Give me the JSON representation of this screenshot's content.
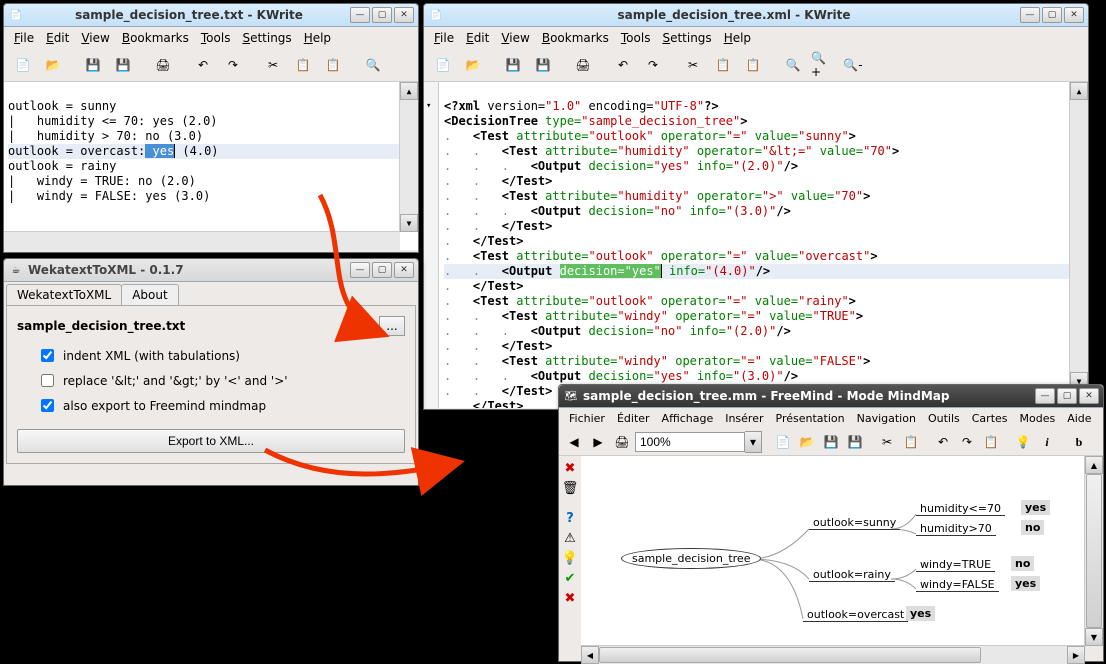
{
  "kwrite1": {
    "title": "sample_decision_tree.txt - KWrite",
    "menus": [
      "File",
      "Edit",
      "View",
      "Bookmarks",
      "Tools",
      "Settings",
      "Help"
    ],
    "lines": [
      {
        "text": "outlook = sunny"
      },
      {
        "text": "|   humidity <= 70: yes (2.0)"
      },
      {
        "text": "|   humidity > 70: no (3.0)"
      },
      {
        "hl": true,
        "prefix": "outlook = overcast:",
        "sel": " yes",
        "cursor": true,
        "suffix": " (4.0)"
      },
      {
        "text": "outlook = rainy"
      },
      {
        "text": "|   windy = TRUE: no (2.0)"
      },
      {
        "text": "|   windy = FALSE: yes (3.0)"
      }
    ]
  },
  "kwrite2": {
    "title": "sample_decision_tree.xml - KWrite",
    "menus": [
      "File",
      "Edit",
      "View",
      "Bookmarks",
      "Tools",
      "Settings",
      "Help"
    ]
  },
  "converter": {
    "title": "WekatextToXML - 0.1.7",
    "tab1": "WekatextToXML",
    "tab2": "About",
    "filename": "sample_decision_tree.txt",
    "opt_indent": "indent XML (with tabulations)",
    "opt_replace": "replace '&lt;' and '&gt;' by '<' and '>'",
    "opt_freemind": "also export to Freemind mindmap",
    "export_btn": "Export to XML..."
  },
  "freemind": {
    "title": "sample_decision_tree.mm - FreeMind - Mode MindMap",
    "menus": [
      "Fichier",
      "Éditer",
      "Affichage",
      "Insérer",
      "Présentation",
      "Navigation",
      "Outils",
      "Cartes",
      "Modes",
      "Aide"
    ],
    "zoom": "100%",
    "root": "sample_decision_tree",
    "b1": "outlook=sunny",
    "b2": "outlook=rainy",
    "b3": "outlook=overcast",
    "l1a": "humidity<=70",
    "l1a_val": "yes",
    "l1b": "humidity>70",
    "l1b_val": "no",
    "l2a": "windy=TRUE",
    "l2a_val": "no",
    "l2b": "windy=FALSE",
    "l2b_val": "yes",
    "l3_val": "yes"
  },
  "xml": {
    "l1": "<?xml version=\"1.0\" encoding=\"UTF-8\"?>",
    "tree_type": "sample_decision_tree"
  }
}
